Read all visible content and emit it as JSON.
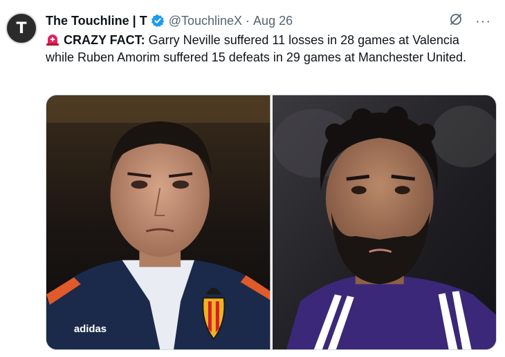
{
  "tweet": {
    "avatar_letter": "T",
    "display_name": "The Touchline | T",
    "handle": "@TouchlineX",
    "separator": "·",
    "date": "Aug 26",
    "more_label": "···",
    "text_prefix": "CRAZY FACT:",
    "text_body": " Garry Neville suffered 11 losses in 28 games at Valencia while Ruben Amorim suffered 15 defeats in 29 games at Manchester United."
  },
  "icons": {
    "avatar": "touchline-logo",
    "verified": "verified-badge-icon",
    "grok": "grok-icon",
    "more": "more-icon",
    "siren": "siren-icon"
  },
  "media": {
    "left_logo_text": "adidas"
  },
  "colors": {
    "verified": "#1d9bf0",
    "handle": "#536471",
    "text": "#0f1419",
    "siren": "#e0245e"
  }
}
